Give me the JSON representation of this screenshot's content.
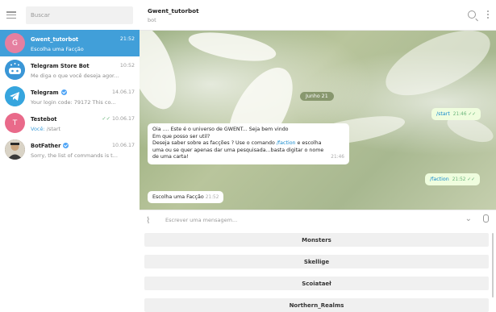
{
  "sidebar": {
    "search_placeholder": "Buscar",
    "chats": [
      {
        "name": "Gwent_tutorbot",
        "time": "21:52",
        "preview": "Escolha uma Facção",
        "avatar_letter": "G",
        "avatar_color": "#e57fa0",
        "active": true
      },
      {
        "name": "Telegram Store Bot",
        "time": "10:52",
        "preview": "Me diga o que você deseja agor...",
        "avatar_color": "#3a96d6"
      },
      {
        "name": "Telegram",
        "time": "14.06.17",
        "preview": "Your login code: 79172  This co...",
        "avatar_color": "#36a5de",
        "verified": true
      },
      {
        "name": "Testebot",
        "time": "10.06.17",
        "preview_prefix": "Você:",
        "preview": "/start",
        "avatar_letter": "T",
        "avatar_color": "#e96a8a"
      },
      {
        "name": "BotFather",
        "time": "10.06.17",
        "preview": "Sorry, the list of commands is t...",
        "avatar_color": "#7a6a55",
        "verified": true
      }
    ]
  },
  "header": {
    "title": "Gwent_tutorbot",
    "subtitle": "bot"
  },
  "messages": {
    "date": "Junho 21",
    "start_cmd": "/start",
    "start_time": "21:46",
    "bot_line1": "Oia .... Este é o universo de GWENT... Seja bem vindo",
    "bot_line2": "Em que posso ser util?",
    "bot_line3a": "Deseja saber sobre as facções ? Use o comando ",
    "bot_line3_link": "/faction",
    "bot_line3b": " e escolha",
    "bot_line4": "uma ou se quer apenas dar uma pesquisada...basta digitar o nome",
    "bot_line5": "de uma carta!",
    "bot_time": "21:46",
    "faction_cmd": "/faction",
    "faction_time": "21:52",
    "choose_text": "Escolha uma Facção",
    "choose_time": "21:52"
  },
  "composer": {
    "placeholder": "Escrever uma mensagem..."
  },
  "keyboard": {
    "buttons": [
      "Monsters",
      "Skellige",
      "Scoiataeł",
      "Northern_Realms"
    ]
  },
  "colors": {
    "accent": "#419fd9",
    "out_bubble": "#effdde",
    "check": "#6ab47a"
  }
}
